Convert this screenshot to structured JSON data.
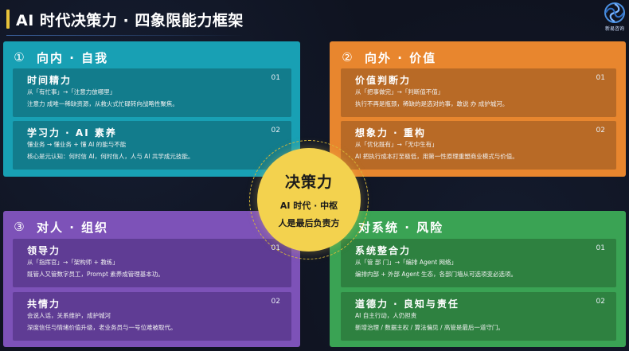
{
  "title": "AI 时代决策力 · 四象限能力框架",
  "logo": {
    "text": "新易咨询",
    "icon": "swirl-logo-icon"
  },
  "center": {
    "title": "决策力",
    "line1": "AI 时代 · 中枢",
    "line2": "人是最后负责方"
  },
  "quadrants": [
    {
      "number": "①",
      "heading": "向内 · 自我",
      "color": "#18a0b4",
      "cards": [
        {
          "title": "时间精力",
          "num": "01",
          "line1": "从「有忙事」→「注意力放哪里」",
          "line2": "注意力 成唯一稀缺资源，从救火式忙碌转向战略性聚焦。"
        },
        {
          "title": "学习力 · AI 素养",
          "num": "02",
          "line1": "懂业务 → 懂业务 + 懂 AI 的能与不能",
          "line2": "核心是元认知：何时信 AI，何时信人，人与 AI 共学成元技能。"
        }
      ]
    },
    {
      "number": "②",
      "heading": "向外 · 价值",
      "color": "#e8862e",
      "cards": [
        {
          "title": "价值判断力",
          "num": "01",
          "line1": "从「把事做完」→「判断值不值」",
          "line2": "执行不再是瓶颈，稀缺的是选对的事，敢说 办 成护城河。"
        },
        {
          "title": "想象力 · 重构",
          "num": "02",
          "line1": "从「优化既有」→「无中生有」",
          "line2": "AI 把执行成本打至极低，用第一性原理重塑商业模式与价值。"
        }
      ]
    },
    {
      "number": "③",
      "heading": "对人 · 组织",
      "color": "#7d52b8",
      "cards": [
        {
          "title": "领导力",
          "num": "01",
          "line1": "从「指挥官」→「架构师 + 教练」",
          "line2": "既管人又管数字员工，Prompt 素养成管理基本功。"
        },
        {
          "title": "共情力",
          "num": "02",
          "line1": "会说人话，关系维护，成护城河",
          "line2": "深度信任与情绪价值升级，老业务员与一号位难被取代。"
        }
      ]
    },
    {
      "number": "",
      "heading": "对系统 · 风险",
      "color": "#3aa354",
      "cards": [
        {
          "title": "系统整合力",
          "num": "01",
          "line1": "从「管 部 门」→「编排 Agent 网络」",
          "line2": "编排内部 + 外部 Agent 生态，各部门墙从可选项变必选项。"
        },
        {
          "title": "道德力 · 良知与责任",
          "num": "02",
          "line1": "AI 自主行动，人仍担责",
          "line2": "新增治理 / 数据主权 / 算法偏见 / 高管是最后一道守门。"
        }
      ]
    }
  ]
}
